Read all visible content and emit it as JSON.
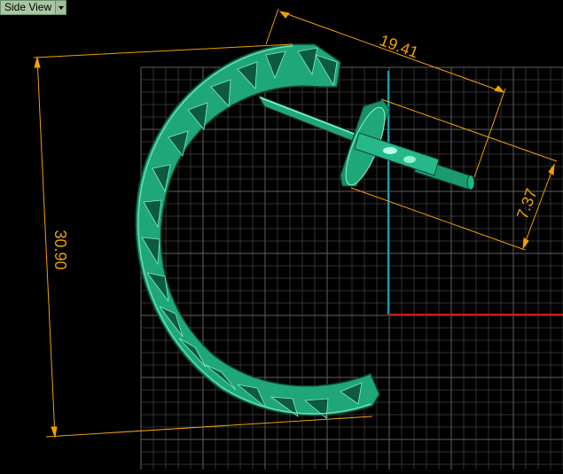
{
  "view": {
    "label": "Side View"
  },
  "colors": {
    "background": "#000000",
    "grid": "#5f5f5f",
    "model": "#1fa77a",
    "model_edge": "#7ff0c8",
    "dimension": "#f0a000",
    "axis_y": "#1aa0b0",
    "axis_x": "#d01818"
  },
  "dimensions": {
    "top": "19.41",
    "left": "30.90",
    "right": "7.37"
  }
}
